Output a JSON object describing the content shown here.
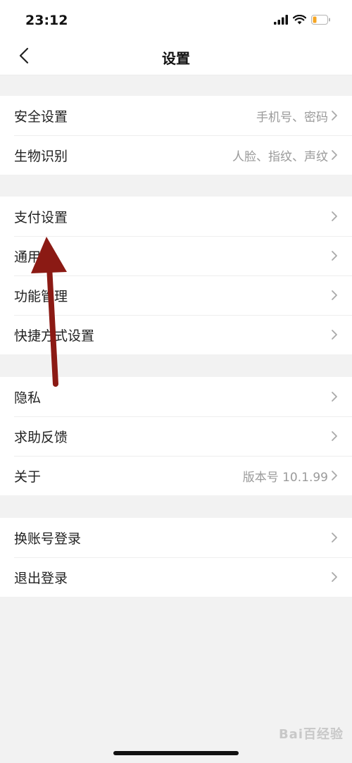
{
  "status_bar": {
    "time": "23:12"
  },
  "nav": {
    "title": "设置"
  },
  "groups": [
    {
      "items": [
        {
          "label": "安全设置",
          "value": "手机号、密码"
        },
        {
          "label": "生物识别",
          "value": "人脸、指纹、声纹"
        }
      ]
    },
    {
      "items": [
        {
          "label": "支付设置",
          "value": ""
        },
        {
          "label": "通用",
          "value": ""
        },
        {
          "label": "功能管理",
          "value": ""
        },
        {
          "label": "快捷方式设置",
          "value": ""
        }
      ]
    },
    {
      "items": [
        {
          "label": "隐私",
          "value": ""
        },
        {
          "label": "求助反馈",
          "value": ""
        },
        {
          "label": "关于",
          "value": "版本号 10.1.99"
        }
      ]
    },
    {
      "items": [
        {
          "label": "换账号登录",
          "value": ""
        },
        {
          "label": "退出登录",
          "value": ""
        }
      ]
    }
  ],
  "annotation": {
    "arrow_color": "#8b1a14"
  },
  "watermark": {
    "text": "Bai百经验"
  }
}
